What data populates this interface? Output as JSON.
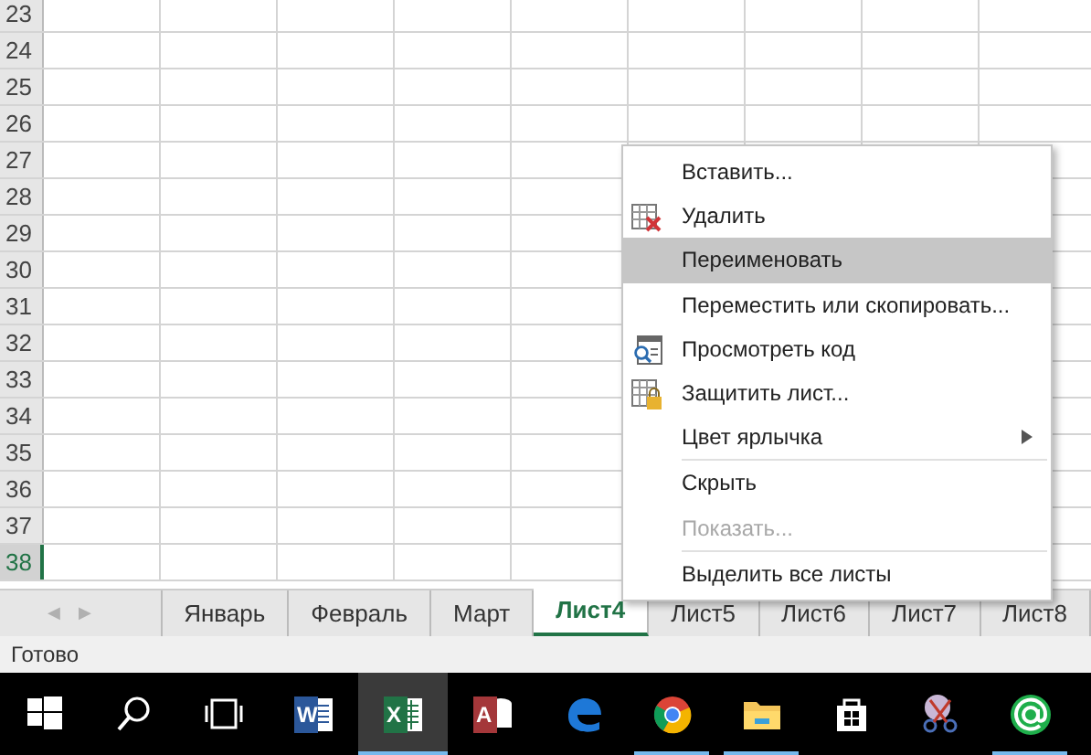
{
  "rows": [
    {
      "number": "23",
      "selected": false
    },
    {
      "number": "24",
      "selected": false
    },
    {
      "number": "25",
      "selected": false
    },
    {
      "number": "26",
      "selected": false
    },
    {
      "number": "27",
      "selected": false
    },
    {
      "number": "28",
      "selected": false
    },
    {
      "number": "29",
      "selected": false
    },
    {
      "number": "30",
      "selected": false
    },
    {
      "number": "31",
      "selected": false
    },
    {
      "number": "32",
      "selected": false
    },
    {
      "number": "33",
      "selected": false
    },
    {
      "number": "34",
      "selected": false
    },
    {
      "number": "35",
      "selected": false
    },
    {
      "number": "36",
      "selected": false
    },
    {
      "number": "37",
      "selected": false
    },
    {
      "number": "38",
      "selected": true
    }
  ],
  "sheet_nav": [
    {
      "label": "◀",
      "disabled": true
    },
    {
      "label": "▶",
      "disabled": true
    }
  ],
  "sheet_tabs": [
    {
      "label": "Январь",
      "selected": false
    },
    {
      "label": "Февраль",
      "selected": false
    },
    {
      "label": "Март",
      "selected": false
    },
    {
      "label": "Лист4",
      "selected": true
    },
    {
      "label": "Лист5",
      "selected": false
    },
    {
      "label": "Лист6",
      "selected": false
    },
    {
      "label": "Лист7",
      "selected": false
    },
    {
      "label": "Лист8",
      "selected": false
    }
  ],
  "context_menu": [
    {
      "label": "Вставить...",
      "kind": "plain",
      "selected": false,
      "disabled": false,
      "separator_before": false,
      "submenu": false
    },
    {
      "label": "Удалить",
      "kind": "delete",
      "selected": false,
      "disabled": false,
      "separator_before": false,
      "submenu": false
    },
    {
      "label": "Переименовать",
      "kind": "plain",
      "selected": true,
      "disabled": false,
      "separator_before": false,
      "submenu": false
    },
    {
      "label": "Переместить или скопировать...",
      "kind": "plain",
      "selected": false,
      "disabled": false,
      "separator_before": false,
      "submenu": false
    },
    {
      "label": "Просмотреть код",
      "kind": "code",
      "selected": false,
      "disabled": false,
      "separator_before": false,
      "submenu": false
    },
    {
      "label": "Защитить лист...",
      "kind": "protect",
      "selected": false,
      "disabled": false,
      "separator_before": false,
      "submenu": false
    },
    {
      "label": "Цвет ярлычка",
      "kind": "plain",
      "selected": false,
      "disabled": false,
      "separator_before": false,
      "submenu": true
    },
    {
      "label": "Скрыть",
      "kind": "plain",
      "selected": false,
      "disabled": false,
      "separator_before": true,
      "submenu": false
    },
    {
      "label": "Показать...",
      "kind": "plain",
      "selected": false,
      "disabled": true,
      "separator_before": false,
      "submenu": false
    },
    {
      "label": "Выделить все листы",
      "kind": "plain",
      "selected": false,
      "disabled": false,
      "separator_before": true,
      "submenu": false
    }
  ],
  "status_bar": {
    "text": "Готово"
  },
  "taskbar": [
    {
      "kind": "start",
      "running": false,
      "active": false
    },
    {
      "kind": "search",
      "running": false,
      "active": false
    },
    {
      "kind": "taskview",
      "running": false,
      "active": false
    },
    {
      "kind": "word",
      "glyph": "W",
      "running": false,
      "active": false
    },
    {
      "kind": "excel",
      "glyph": "X",
      "running": true,
      "active": true
    },
    {
      "kind": "access",
      "glyph": "A",
      "running": false,
      "active": false
    },
    {
      "kind": "edge",
      "running": false,
      "active": false
    },
    {
      "kind": "chrome",
      "running": true,
      "active": false
    },
    {
      "kind": "explorer",
      "running": true,
      "active": false
    },
    {
      "kind": "store",
      "running": false,
      "active": false
    },
    {
      "kind": "snipping",
      "running": false,
      "active": false
    },
    {
      "kind": "mail",
      "running": true,
      "active": false
    }
  ]
}
